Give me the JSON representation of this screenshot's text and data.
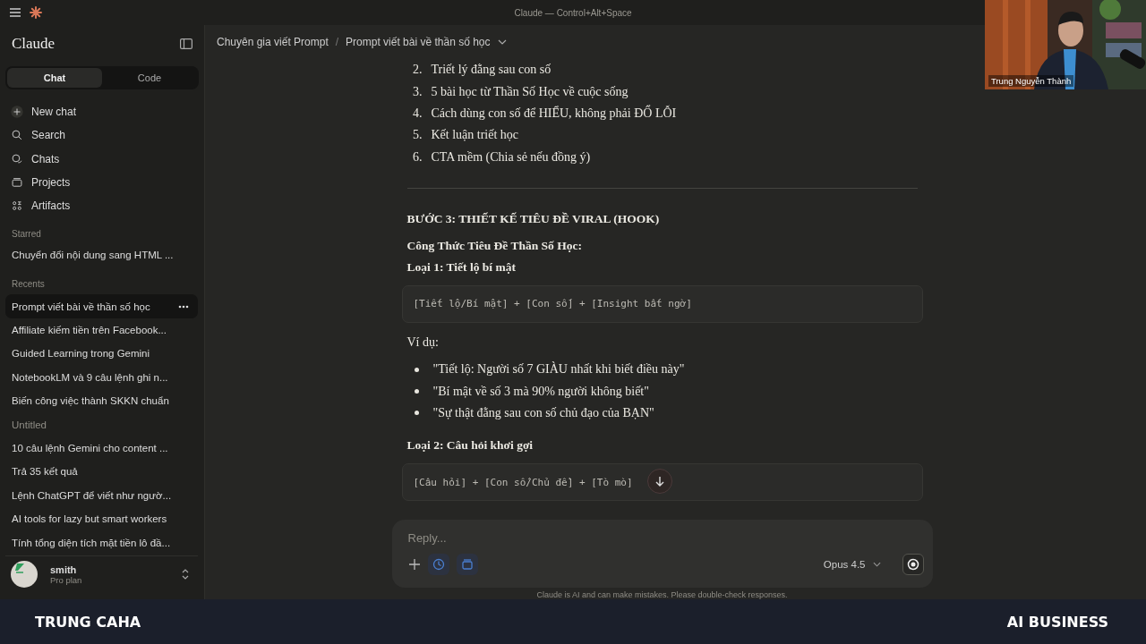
{
  "titlebar": {
    "title": "Claude — Control+Alt+Space"
  },
  "sidebar": {
    "brand": "Claude",
    "mode_tabs": [
      {
        "label": "Chat",
        "selected": true
      },
      {
        "label": "Code",
        "selected": false
      }
    ],
    "nav": [
      {
        "label": "New chat"
      },
      {
        "label": "Search"
      },
      {
        "label": "Chats"
      },
      {
        "label": "Projects"
      },
      {
        "label": "Artifacts"
      }
    ],
    "starred_label": "Starred",
    "starred": [
      {
        "label": "Chuyển đổi nội dung sang HTML ..."
      }
    ],
    "recents_label": "Recents",
    "recents": [
      {
        "label": "Prompt viết bài về thần số học",
        "selected": true,
        "dimmed": false
      },
      {
        "label": "Affiliate kiếm tiền trên Facebook...",
        "selected": false,
        "dimmed": false
      },
      {
        "label": "Guided Learning trong Gemini",
        "selected": false,
        "dimmed": false
      },
      {
        "label": "NotebookLM và 9 câu lệnh ghi n...",
        "selected": false,
        "dimmed": false
      },
      {
        "label": "Biến công việc thành SKKN chuẩn",
        "selected": false,
        "dimmed": false
      },
      {
        "label": "Untitled",
        "selected": false,
        "dimmed": true
      },
      {
        "label": "10 câu lệnh Gemini cho content ...",
        "selected": false,
        "dimmed": false
      },
      {
        "label": "Trả 35 kết quả",
        "selected": false,
        "dimmed": false
      },
      {
        "label": "Lệnh ChatGPT để viết như ngườ...",
        "selected": false,
        "dimmed": false
      },
      {
        "label": "AI tools for lazy but smart workers",
        "selected": false,
        "dimmed": false
      },
      {
        "label": "Tính tổng diện tích mặt tiền lô đầ...",
        "selected": false,
        "dimmed": false
      }
    ],
    "user": {
      "name": "smith",
      "plan": "Pro plan"
    }
  },
  "breadcrumb": {
    "items": [
      "Chuyên gia viết Prompt",
      "Prompt viết bài về thần số học"
    ],
    "separator": "/"
  },
  "content": [
    {
      "kind": "ol",
      "items": [
        {
          "number": "2.",
          "text": "Triết lý đằng sau con số"
        },
        {
          "number": "3.",
          "text": "5 bài học từ Thần Số Học về cuộc sống"
        },
        {
          "number": "4.",
          "text": "Cách dùng con số để HIỂU, không phải ĐỔ LỖI"
        },
        {
          "number": "5.",
          "text": "Kết luận triết học"
        },
        {
          "number": "6.",
          "text": "CTA mềm (Chia sẻ nếu đồng ý)"
        }
      ]
    },
    {
      "kind": "rule"
    },
    {
      "kind": "heading",
      "text": "BƯỚC 3: THIẾT KẾ TIÊU ĐỀ VIRAL (HOOK)"
    },
    {
      "kind": "subheading",
      "text": "Công Thức Tiêu Đề Thần Số Học:"
    },
    {
      "kind": "subheading",
      "text": "Loại 1: Tiết lộ bí mật"
    },
    {
      "kind": "code",
      "text": "[Tiết lộ/Bí mật] + [Con số] + [Insight bất ngờ]"
    },
    {
      "kind": "para",
      "text": "Ví dụ:"
    },
    {
      "kind": "ul",
      "items": [
        "\"Tiết lộ: Người số 7 GIÀU nhất khi biết điều này\"",
        "\"Bí mật về số 3 mà 90% người không biết\"",
        "\"Sự thật đằng sau con số chủ đạo của BẠN\""
      ]
    },
    {
      "kind": "subheading",
      "text": "Loại 2: Câu hỏi khơi gợi"
    },
    {
      "kind": "code",
      "text": "[Câu hỏi] + [Con số/Chủ đề] + [Tò mò]"
    }
  ],
  "composer": {
    "placeholder": "Reply...",
    "model": "Opus 4.5"
  },
  "disclaimer": "Claude is AI and can make mistakes. Please double-check responses.",
  "webcam": {
    "kind": "picture",
    "name": "Trung Nguyễn Thành"
  },
  "banner": {
    "left": "TRUNG CAHA",
    "right": "AI BUSINESS"
  }
}
